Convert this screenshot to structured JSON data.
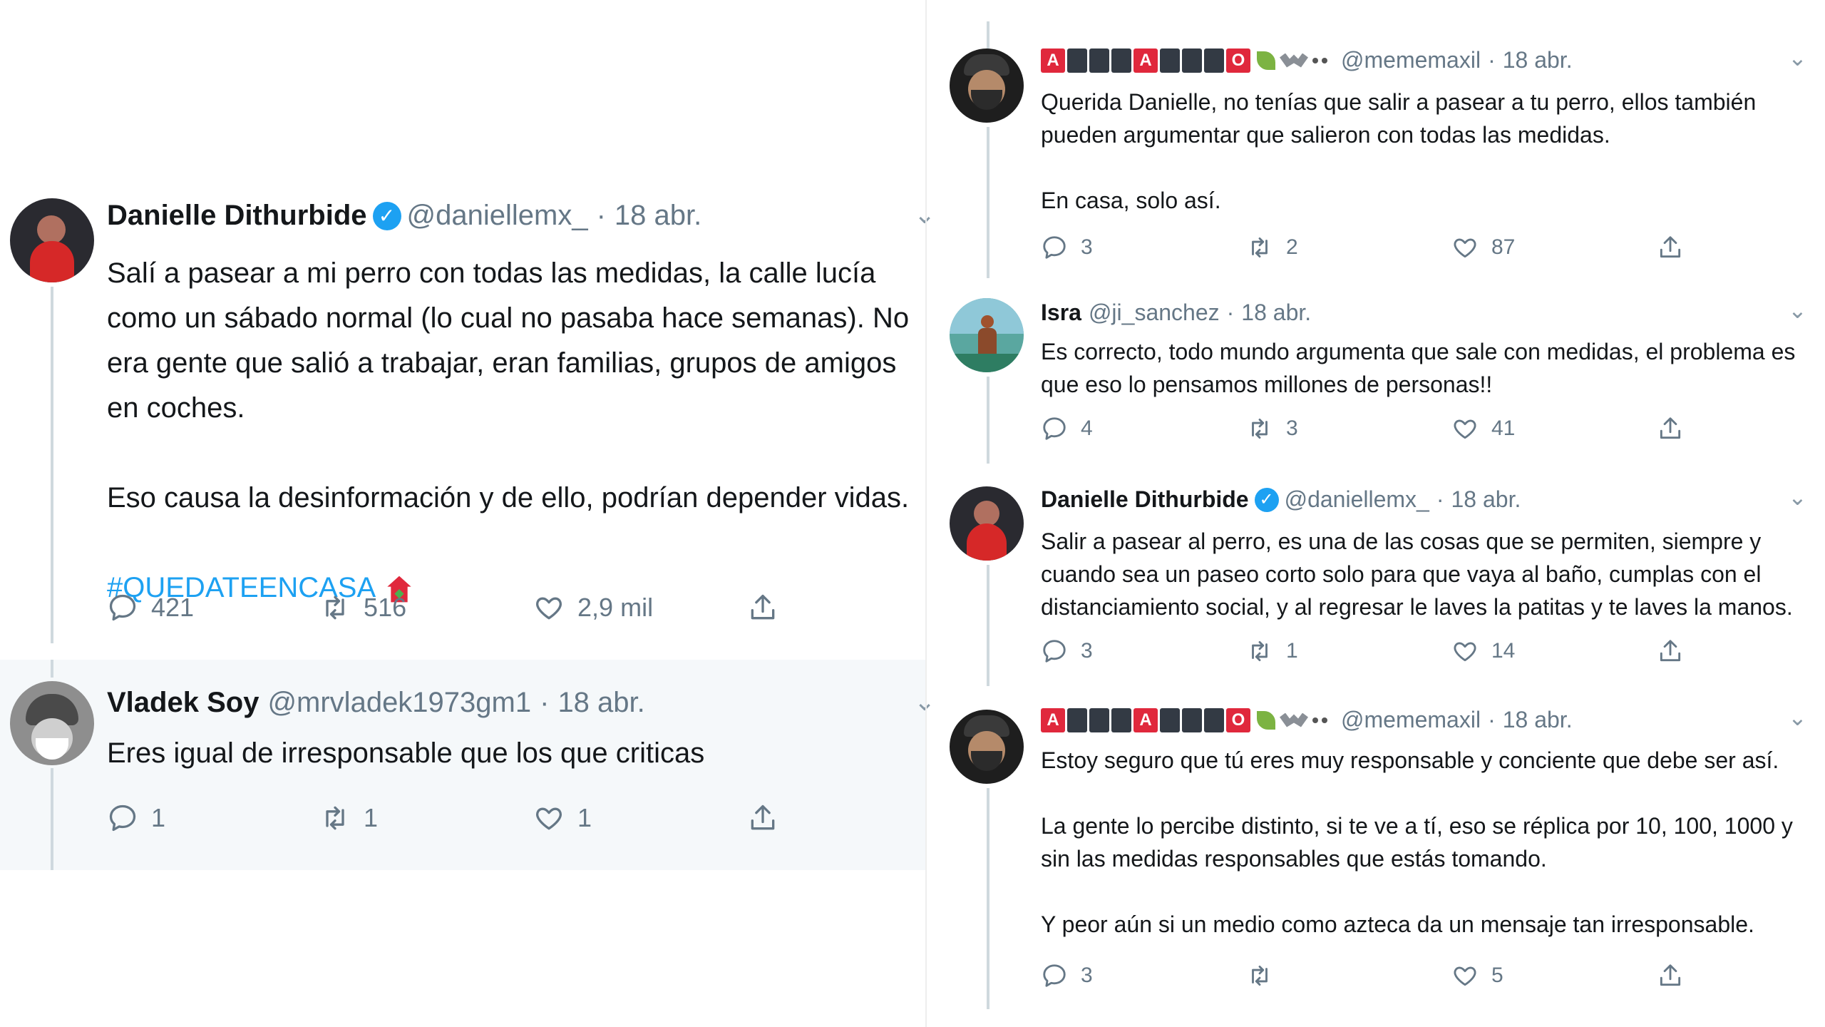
{
  "left_panel": {
    "tweets": [
      {
        "name": "Danielle Dithurbide",
        "verified": true,
        "handle": "@daniellemx_",
        "date": "18 abr.",
        "paragraphs": [
          "Salí a pasear a mi perro con todas las medidas, la calle lucía como un sábado normal (lo cual no pasaba hace semanas). No era gente que salió a trabajar, eran familias, grupos de amigos en coches.",
          "Eso causa la desinformación y de ello, podrían depender vidas."
        ],
        "hashtag": "#QUEDATEENCASA",
        "replies": "421",
        "retweets": "516",
        "likes": "2,9 mil"
      },
      {
        "name": "Vladek Soy",
        "handle": "@mrvladek1973gm1",
        "date": "18 abr.",
        "paragraphs": [
          "Eres igual de irresponsable que los que criticas"
        ],
        "replies": "1",
        "retweets": "1",
        "likes": "1"
      }
    ]
  },
  "right_panel": {
    "tweets": [
      {
        "name_letters": [
          "A",
          "A",
          "O"
        ],
        "handle": "@mememaxil",
        "date": "18 abr.",
        "paragraphs": [
          "Querida Danielle, no tenías que salir a pasear a tu perro, ellos también pueden argumentar que salieron con todas las medidas.",
          "En casa, solo así."
        ],
        "replies": "3",
        "retweets": "2",
        "likes": "87"
      },
      {
        "name": "Isra",
        "handle": "@ji_sanchez",
        "date": "18 abr.",
        "paragraphs": [
          "Es correcto, todo mundo argumenta que sale con medidas, el problema es que eso lo pensamos millones de personas!!"
        ],
        "replies": "4",
        "retweets": "3",
        "likes": "41"
      },
      {
        "name": "Danielle Dithurbide",
        "verified": true,
        "handle": "@daniellemx_",
        "date": "18 abr.",
        "paragraphs": [
          "Salir a pasear al perro, es una de las cosas que se permiten, siempre y cuando sea un paseo corto solo para que vaya al baño, cumplas con el distanciamiento social, y al regresar le laves la patitas y te laves la manos."
        ],
        "replies": "3",
        "retweets": "1",
        "likes": "14"
      },
      {
        "name_letters": [
          "A",
          "A",
          "O"
        ],
        "handle": "@mememaxil",
        "date": "18 abr.",
        "paragraphs": [
          "Estoy seguro que tú eres muy responsable y conciente que debe ser así.",
          "La gente lo percibe distinto, si te ve a tí, eso se réplica por 10, 100, 1000 y sin las medidas responsables que estás tomando.",
          "Y peor aún si un medio como azteca da un mensaje tan irresponsable."
        ],
        "replies": "3",
        "retweets": "",
        "likes": "5"
      }
    ]
  },
  "icons": {
    "reply": "speech-bubble-icon",
    "retweet": "retweet-arrows-icon",
    "like": "heart-icon",
    "share": "share-upload-icon",
    "menu": "chevron-down-icon",
    "verified": "verified-badge-icon"
  },
  "colors": {
    "link": "#1da1f2",
    "text": "#14171a",
    "muted": "#657786",
    "highlight_bg": "#f5f8fa",
    "thread_line": "#cfd9de"
  }
}
